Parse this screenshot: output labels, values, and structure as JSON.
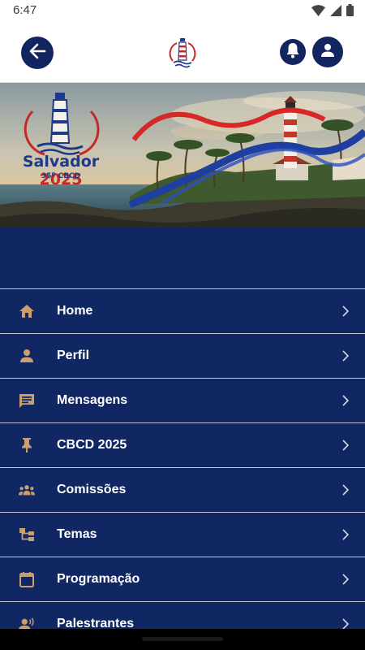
{
  "status_bar": {
    "time": "6:47",
    "icons": [
      "wifi-icon",
      "signal-icon",
      "battery-icon"
    ]
  },
  "header": {
    "back_icon": "arrow-left-icon",
    "logo_icon": "lighthouse-icon",
    "notifications_icon": "bell-icon",
    "profile_icon": "user-icon"
  },
  "hero": {
    "event_name": "Salvador",
    "event_year": "2025",
    "event_edition": "35º CBCD"
  },
  "colors": {
    "primary": "#112763",
    "accent": "#c9a06b",
    "logo_red": "#c62828",
    "text": "#ffffff"
  },
  "menu": {
    "items": [
      {
        "label": "Home",
        "icon": "home-icon"
      },
      {
        "label": "Perfil",
        "icon": "person-icon"
      },
      {
        "label": "Mensagens",
        "icon": "message-icon"
      },
      {
        "label": "CBCD 2025",
        "icon": "pin-icon"
      },
      {
        "label": "Comissões",
        "icon": "groups-icon"
      },
      {
        "label": "Temas",
        "icon": "topics-icon"
      },
      {
        "label": "Programação",
        "icon": "calendar-icon"
      },
      {
        "label": "Palestrantes",
        "icon": "speaker-icon"
      }
    ]
  }
}
